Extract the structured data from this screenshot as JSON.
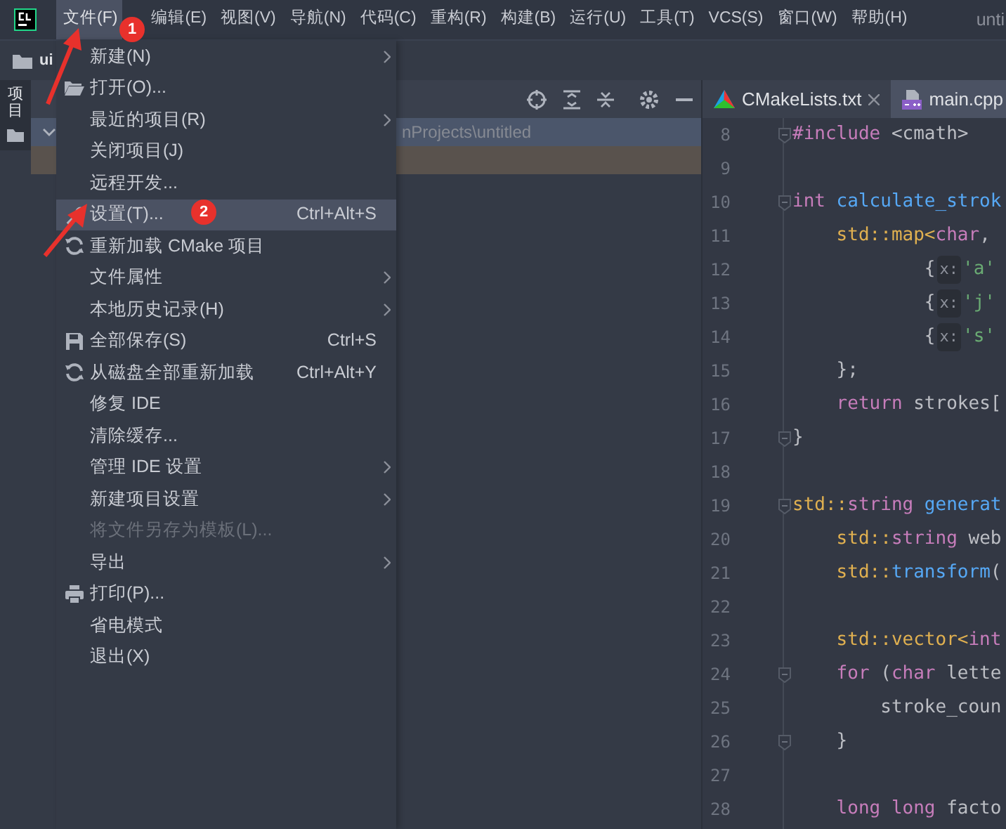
{
  "menu_bar": {
    "items": [
      {
        "label": "文件(F)",
        "selected": true
      },
      {
        "label": "编辑(E)",
        "selected": false
      },
      {
        "label": "视图(V)",
        "selected": false
      },
      {
        "label": "导航(N)",
        "selected": false
      },
      {
        "label": "代码(C)",
        "selected": false
      },
      {
        "label": "重构(R)",
        "selected": false
      },
      {
        "label": "构建(B)",
        "selected": false
      },
      {
        "label": "运行(U)",
        "selected": false
      },
      {
        "label": "工具(T)",
        "selected": false
      },
      {
        "label": "VCS(S)",
        "selected": false
      },
      {
        "label": "窗口(W)",
        "selected": false
      },
      {
        "label": "帮助(H)",
        "selected": false
      }
    ],
    "title": "unti"
  },
  "nav_bar": {
    "project": "ui"
  },
  "tool_window_strip": {
    "label": "项目"
  },
  "project_panel": {
    "rows": [
      {
        "text": "nProjects\\untitled",
        "selected": true
      }
    ]
  },
  "editor": {
    "tabs": [
      {
        "label": "CMakeLists.txt",
        "selected": false,
        "closable": true
      },
      {
        "label": "main.cpp",
        "selected": true,
        "closable": false
      }
    ],
    "lines": [
      {
        "number": "8",
        "fold": true,
        "tokens": [
          {
            "kind": "keyword",
            "text": "#include"
          },
          {
            "kind": "plain",
            "text": " <cmath>"
          }
        ]
      },
      {
        "number": "9",
        "fold": false
      },
      {
        "number": "10",
        "fold": true,
        "tokens": [
          {
            "kind": "keyword",
            "text": "int"
          },
          {
            "kind": "function",
            "text": " calculate_strok"
          }
        ]
      },
      {
        "number": "11",
        "fold": false,
        "tokens": [
          {
            "kind": "namespace",
            "text": "    std::map<"
          },
          {
            "kind": "keyword",
            "text": "char"
          },
          {
            "kind": "plain",
            "text": ","
          }
        ]
      },
      {
        "number": "12",
        "fold": false,
        "tokens": [
          {
            "kind": "plain",
            "text": "            {"
          },
          {
            "kind": "hint",
            "text": "x:"
          },
          {
            "kind": "string",
            "text": "'a'"
          }
        ]
      },
      {
        "number": "13",
        "fold": false,
        "tokens": [
          {
            "kind": "plain",
            "text": "            {"
          },
          {
            "kind": "hint",
            "text": "x:"
          },
          {
            "kind": "string",
            "text": "'j'"
          }
        ]
      },
      {
        "number": "14",
        "fold": false,
        "tokens": [
          {
            "kind": "plain",
            "text": "            {"
          },
          {
            "kind": "hint",
            "text": "x:"
          },
          {
            "kind": "string",
            "text": "'s'"
          }
        ]
      },
      {
        "number": "15",
        "fold": false,
        "tokens": [
          {
            "kind": "plain",
            "text": "    };"
          }
        ]
      },
      {
        "number": "16",
        "fold": false,
        "tokens": [
          {
            "kind": "keyword",
            "text": "    return"
          },
          {
            "kind": "plain",
            "text": " strokes["
          }
        ]
      },
      {
        "number": "17",
        "fold": true,
        "tokens": [
          {
            "kind": "plain",
            "text": "}"
          }
        ]
      },
      {
        "number": "18",
        "fold": false
      },
      {
        "number": "19",
        "fold": true,
        "tokens": [
          {
            "kind": "namespace",
            "text": "std::"
          },
          {
            "kind": "keyword",
            "text": "string"
          },
          {
            "kind": "function",
            "text": " generat"
          }
        ]
      },
      {
        "number": "20",
        "fold": false,
        "tokens": [
          {
            "kind": "namespace",
            "text": "    std::"
          },
          {
            "kind": "keyword",
            "text": "string"
          },
          {
            "kind": "plain",
            "text": " web"
          }
        ]
      },
      {
        "number": "21",
        "fold": false,
        "tokens": [
          {
            "kind": "namespace",
            "text": "    std::"
          },
          {
            "kind": "function",
            "text": "transform"
          },
          {
            "kind": "plain",
            "text": "("
          }
        ]
      },
      {
        "number": "22",
        "fold": false
      },
      {
        "number": "23",
        "fold": false,
        "tokens": [
          {
            "kind": "namespace",
            "text": "    std::vector<"
          },
          {
            "kind": "keyword",
            "text": "int"
          }
        ]
      },
      {
        "number": "24",
        "fold": true,
        "tokens": [
          {
            "kind": "keyword",
            "text": "    for"
          },
          {
            "kind": "plain",
            "text": " ("
          },
          {
            "kind": "keyword",
            "text": "char"
          },
          {
            "kind": "plain",
            "text": " lette"
          }
        ]
      },
      {
        "number": "25",
        "fold": false,
        "tokens": [
          {
            "kind": "plain",
            "text": "        stroke_coun"
          }
        ]
      },
      {
        "number": "26",
        "fold": true,
        "tokens": [
          {
            "kind": "plain",
            "text": "    }"
          }
        ]
      },
      {
        "number": "27",
        "fold": false
      },
      {
        "number": "28",
        "fold": false,
        "tokens": [
          {
            "kind": "keyword",
            "text": "    long long"
          },
          {
            "kind": "plain",
            "text": " facto"
          }
        ]
      }
    ]
  },
  "file_menu": {
    "items": [
      {
        "label": "新建(N)",
        "kind": "plain",
        "submenu": true,
        "disabled": false,
        "selected": false
      },
      {
        "label": "打开(O)...",
        "kind": "folder",
        "submenu": false,
        "disabled": false,
        "selected": false
      },
      {
        "label": "最近的项目(R)",
        "kind": "plain",
        "submenu": true,
        "disabled": false,
        "selected": false
      },
      {
        "label": "关闭项目(J)",
        "kind": "plain",
        "submenu": false,
        "disabled": false,
        "selected": false
      },
      {
        "label": "远程开发...",
        "kind": "plain",
        "submenu": false,
        "disabled": false,
        "selected": false
      },
      {
        "label": "设置(T)...",
        "kind": "wrench",
        "shortcut": "Ctrl+Alt+S",
        "submenu": false,
        "disabled": false,
        "selected": true
      },
      {
        "label": "重新加载 CMake 项目",
        "kind": "reload",
        "submenu": false,
        "disabled": false,
        "selected": false
      },
      {
        "label": "文件属性",
        "kind": "plain",
        "submenu": true,
        "disabled": false,
        "selected": false
      },
      {
        "label": "本地历史记录(H)",
        "kind": "plain",
        "submenu": true,
        "disabled": false,
        "selected": false
      },
      {
        "label": "全部保存(S)",
        "kind": "save",
        "shortcut": "Ctrl+S",
        "submenu": false,
        "disabled": false,
        "selected": false
      },
      {
        "label": "从磁盘全部重新加载",
        "kind": "reload",
        "shortcut": "Ctrl+Alt+Y",
        "submenu": false,
        "disabled": false,
        "selected": false
      },
      {
        "label": "修复 IDE",
        "kind": "plain",
        "submenu": false,
        "disabled": false,
        "selected": false
      },
      {
        "label": "清除缓存...",
        "kind": "plain",
        "submenu": false,
        "disabled": false,
        "selected": false
      },
      {
        "label": "管理 IDE 设置",
        "kind": "plain",
        "submenu": true,
        "disabled": false,
        "selected": false
      },
      {
        "label": "新建项目设置",
        "kind": "plain",
        "submenu": true,
        "disabled": false,
        "selected": false
      },
      {
        "label": "将文件另存为模板(L)...",
        "kind": "plain",
        "submenu": false,
        "disabled": true,
        "selected": false
      },
      {
        "label": "导出",
        "kind": "plain",
        "submenu": true,
        "disabled": false,
        "selected": false
      },
      {
        "label": "打印(P)...",
        "kind": "printer",
        "submenu": false,
        "disabled": false,
        "selected": false
      },
      {
        "label": "省电模式",
        "kind": "plain",
        "submenu": false,
        "disabled": false,
        "selected": false
      },
      {
        "label": "退出(X)",
        "kind": "plain",
        "submenu": false,
        "disabled": false,
        "selected": false
      }
    ]
  },
  "annotations": [
    {
      "label": "1"
    },
    {
      "label": "2"
    }
  ]
}
